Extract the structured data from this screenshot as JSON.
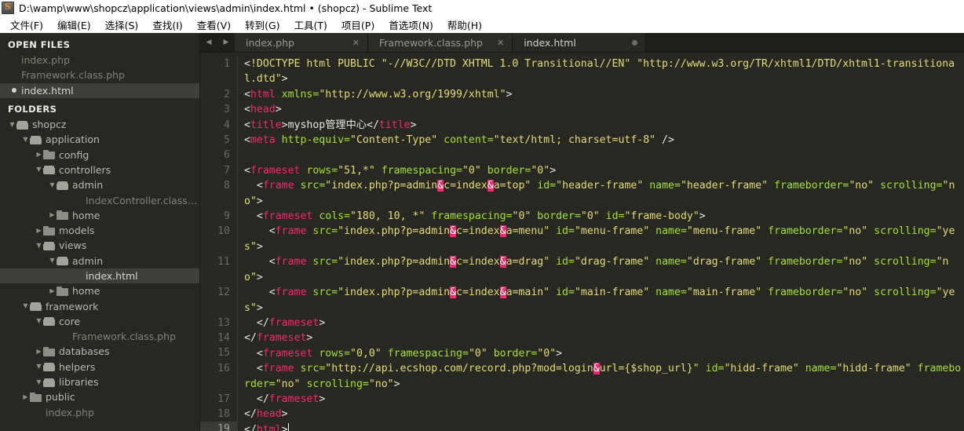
{
  "window": {
    "icon": "sublime-text-icon",
    "title": "D:\\wamp\\www\\shopcz\\application\\views\\admin\\index.html • (shopcz) - Sublime Text"
  },
  "menubar": {
    "items": [
      {
        "label": "文件(F)"
      },
      {
        "label": "编辑(E)"
      },
      {
        "label": "选择(S)"
      },
      {
        "label": "查找(I)"
      },
      {
        "label": "查看(V)"
      },
      {
        "label": "转到(G)"
      },
      {
        "label": "工具(T)"
      },
      {
        "label": "项目(P)"
      },
      {
        "label": "首选项(N)"
      },
      {
        "label": "帮助(H)"
      }
    ]
  },
  "sidebar": {
    "open_files_header": "OPEN FILES",
    "open_files": [
      {
        "label": "index.php",
        "selected": false,
        "modified": false
      },
      {
        "label": "Framework.class.php",
        "selected": false,
        "modified": false
      },
      {
        "label": "index.html",
        "selected": true,
        "modified": true
      }
    ],
    "folders_header": "FOLDERS",
    "tree": [
      {
        "label": "shopcz",
        "depth": 0,
        "kind": "folder-open",
        "arrow": "down",
        "selected": false
      },
      {
        "label": "application",
        "depth": 1,
        "kind": "folder-open",
        "arrow": "down",
        "selected": false
      },
      {
        "label": "config",
        "depth": 2,
        "kind": "folder-closed",
        "arrow": "right",
        "selected": false
      },
      {
        "label": "controllers",
        "depth": 2,
        "kind": "folder-open",
        "arrow": "down",
        "selected": false
      },
      {
        "label": "admin",
        "depth": 3,
        "kind": "folder-open",
        "arrow": "down",
        "selected": false
      },
      {
        "label": "IndexController.class.php",
        "depth": 4,
        "kind": "file",
        "arrow": "none",
        "selected": false
      },
      {
        "label": "home",
        "depth": 3,
        "kind": "folder-closed",
        "arrow": "right",
        "selected": false
      },
      {
        "label": "models",
        "depth": 2,
        "kind": "folder-closed",
        "arrow": "right",
        "selected": false
      },
      {
        "label": "views",
        "depth": 2,
        "kind": "folder-open",
        "arrow": "down",
        "selected": false
      },
      {
        "label": "admin",
        "depth": 3,
        "kind": "folder-open",
        "arrow": "down",
        "selected": false
      },
      {
        "label": "index.html",
        "depth": 4,
        "kind": "file",
        "arrow": "none",
        "selected": true
      },
      {
        "label": "home",
        "depth": 3,
        "kind": "folder-closed",
        "arrow": "right",
        "selected": false
      },
      {
        "label": "framework",
        "depth": 1,
        "kind": "folder-open",
        "arrow": "down",
        "selected": false
      },
      {
        "label": "core",
        "depth": 2,
        "kind": "folder-open",
        "arrow": "down",
        "selected": false
      },
      {
        "label": "Framework.class.php",
        "depth": 3,
        "kind": "file",
        "arrow": "none",
        "selected": false
      },
      {
        "label": "databases",
        "depth": 2,
        "kind": "folder-closed",
        "arrow": "right",
        "selected": false
      },
      {
        "label": "helpers",
        "depth": 2,
        "kind": "folder-open",
        "arrow": "down",
        "selected": false
      },
      {
        "label": "libraries",
        "depth": 2,
        "kind": "folder-open",
        "arrow": "down",
        "selected": false
      },
      {
        "label": "public",
        "depth": 1,
        "kind": "folder-closed",
        "arrow": "right",
        "selected": false
      },
      {
        "label": "index.php",
        "depth": 1,
        "kind": "file",
        "arrow": "none",
        "selected": false
      }
    ]
  },
  "tabbar": {
    "prev_icon": "chevron-left-icon",
    "next_icon": "chevron-right-icon",
    "tabs": [
      {
        "label": "index.php",
        "active": false,
        "modified": false,
        "close_glyph": "✕"
      },
      {
        "label": "Framework.class.php",
        "active": false,
        "modified": false,
        "close_glyph": "✕"
      },
      {
        "label": "index.html",
        "active": true,
        "modified": true,
        "close_glyph": "✕"
      }
    ]
  },
  "editor": {
    "cursor_line": 19,
    "line_numbers": [
      1,
      2,
      3,
      4,
      5,
      6,
      7,
      8,
      9,
      10,
      11,
      12,
      13,
      14,
      15,
      16,
      17,
      18,
      19
    ],
    "lines": [
      "<!DOCTYPE html PUBLIC \"-//W3C//DTD XHTML 1.0 Transitional//EN\" \"http://www.w3.org/TR/xhtml1/DTD/xhtml1-transitional.dtd\">",
      "<html xmlns=\"http://www.w3.org/1999/xhtml\">",
      "<head>",
      "<title>myshop管理中心</title>",
      "<meta http-equiv=\"Content-Type\" content=\"text/html; charset=utf-8\" />",
      "",
      "<frameset rows=\"51,*\" framespacing=\"0\" border=\"0\">",
      "  <frame src=\"index.php?p=admin&c=index&a=top\" id=\"header-frame\" name=\"header-frame\" frameborder=\"no\" scrolling=\"no\">",
      "  <frameset cols=\"180, 10, *\" framespacing=\"0\" border=\"0\" id=\"frame-body\">",
      "    <frame src=\"index.php?p=admin&c=index&a=menu\" id=\"menu-frame\" name=\"menu-frame\" frameborder=\"no\" scrolling=\"yes\">",
      "    <frame src=\"index.php?p=admin&c=index&a=drag\" id=\"drag-frame\" name=\"drag-frame\" frameborder=\"no\" scrolling=\"no\">",
      "    <frame src=\"index.php?p=admin&c=index&a=main\" id=\"main-frame\" name=\"main-frame\" frameborder=\"no\" scrolling=\"yes\">",
      "  </frameset>",
      "</frameset>",
      "  <frameset rows=\"0,0\" framespacing=\"0\" border=\"0\">",
      "  <frame src=\"http://api.ecshop.com/record.php?mod=login&url={$shop_url}\" id=\"hidd-frame\" name=\"hidd-frame\" frameborder=\"no\" scrolling=\"no\">",
      "  </frameset>",
      "</head>",
      "</html>"
    ]
  },
  "colors": {
    "editor_bg": "#272822",
    "sidebar_bg": "#272822",
    "tag": "#f92672",
    "attribute": "#a6e22e",
    "string": "#e6db74",
    "invalid_bg": "#f92672",
    "selection_row": "#3e3f39",
    "titlebar_bg": "#ffffff"
  }
}
